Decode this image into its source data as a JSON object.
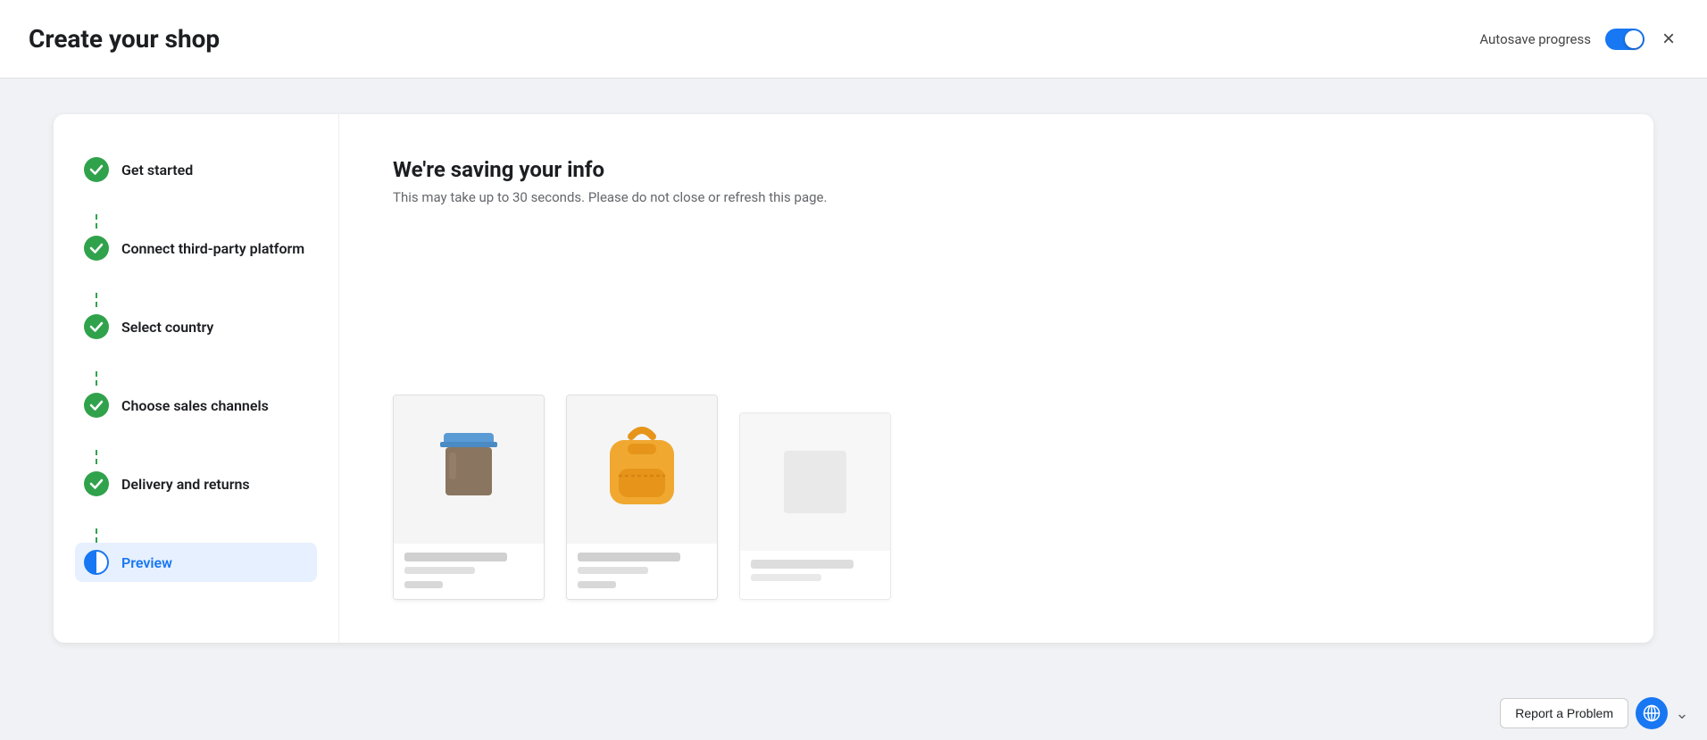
{
  "header": {
    "title": "Create your shop",
    "autosave_label": "Autosave progress",
    "close_label": "×"
  },
  "sidebar": {
    "steps": [
      {
        "id": "get-started",
        "label": "Get started",
        "status": "complete",
        "active": false
      },
      {
        "id": "connect-platform",
        "label": "Connect third-party platform",
        "status": "complete",
        "active": false
      },
      {
        "id": "select-country",
        "label": "Select country",
        "status": "complete",
        "active": false
      },
      {
        "id": "sales-channels",
        "label": "Choose sales channels",
        "status": "complete",
        "active": false
      },
      {
        "id": "delivery-returns",
        "label": "Delivery and returns",
        "status": "complete",
        "active": false
      },
      {
        "id": "preview",
        "label": "Preview",
        "status": "active",
        "active": true
      }
    ]
  },
  "main": {
    "saving_title": "We're saving your info",
    "saving_subtitle": "This may take up to 30 seconds. Please do not close or refresh this page."
  },
  "footer": {
    "report_btn": "Report a Problem"
  }
}
